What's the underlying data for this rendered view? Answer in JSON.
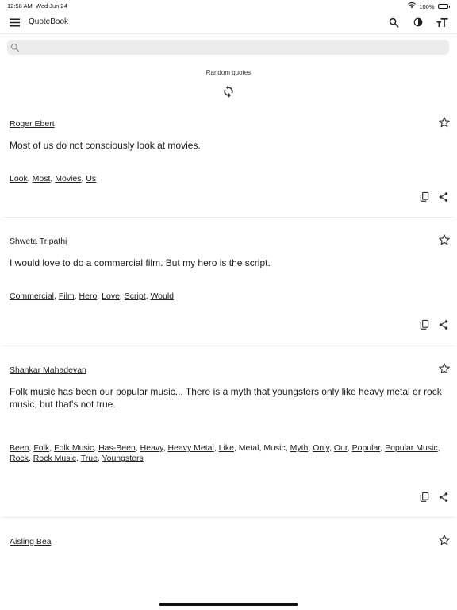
{
  "status_bar": {
    "time": "12:58 AM",
    "date": "Wed Jun 24",
    "battery": "100%",
    "battery_level": 1.0
  },
  "app_bar": {
    "title": "QuoteBook",
    "icons": [
      "menu-icon",
      "search-icon",
      "contrast-icon",
      "text-size-icon"
    ]
  },
  "search": {
    "placeholder": "",
    "value": ""
  },
  "random": {
    "label": "Random quotes",
    "icon": "refresh-icon"
  },
  "cards": [
    {
      "author": "Roger Ebert",
      "quote": "Most of us do not consciously look at movies.",
      "tags": [
        {
          "text": "Look",
          "link": true
        },
        {
          "text": "Most",
          "link": true
        },
        {
          "text": "Movies",
          "link": true
        },
        {
          "text": "Us",
          "link": true
        }
      ]
    },
    {
      "author": "Shweta Tripathi",
      "quote": "I would love to do a commercial film. But my hero is the script.",
      "tags": [
        {
          "text": "Commercial",
          "link": true
        },
        {
          "text": "Film",
          "link": true
        },
        {
          "text": "Hero",
          "link": true
        },
        {
          "text": "Love",
          "link": true
        },
        {
          "text": "Script",
          "link": true
        },
        {
          "text": "Would",
          "link": true
        }
      ]
    },
    {
      "author": "Shankar Mahadevan",
      "quote": "Folk music has been our popular music... There is a myth that youngsters only like heavy metal or rock music, but that's not true.",
      "tags": [
        {
          "text": "Been",
          "link": true
        },
        {
          "text": "Folk",
          "link": true
        },
        {
          "text": "Folk Music",
          "link": true
        },
        {
          "text": "Has-Been",
          "link": true
        },
        {
          "text": "Heavy",
          "link": true
        },
        {
          "text": "Heavy Metal",
          "link": true
        },
        {
          "text": "Like",
          "link": true
        },
        {
          "text": "Metal",
          "link": false
        },
        {
          "text": "Music",
          "link": false
        },
        {
          "text": "Myth",
          "link": true
        },
        {
          "text": "Only",
          "link": true
        },
        {
          "text": "Our",
          "link": true
        },
        {
          "text": "Popular",
          "link": true
        },
        {
          "text": "Popular Music",
          "link": true
        },
        {
          "text": "Rock",
          "link": true
        },
        {
          "text": "Rock Music",
          "link": true
        },
        {
          "text": "True",
          "link": true
        },
        {
          "text": "Youngsters",
          "link": true
        }
      ]
    },
    {
      "author": "Aisling Bea",
      "quote": "",
      "tags": []
    }
  ]
}
